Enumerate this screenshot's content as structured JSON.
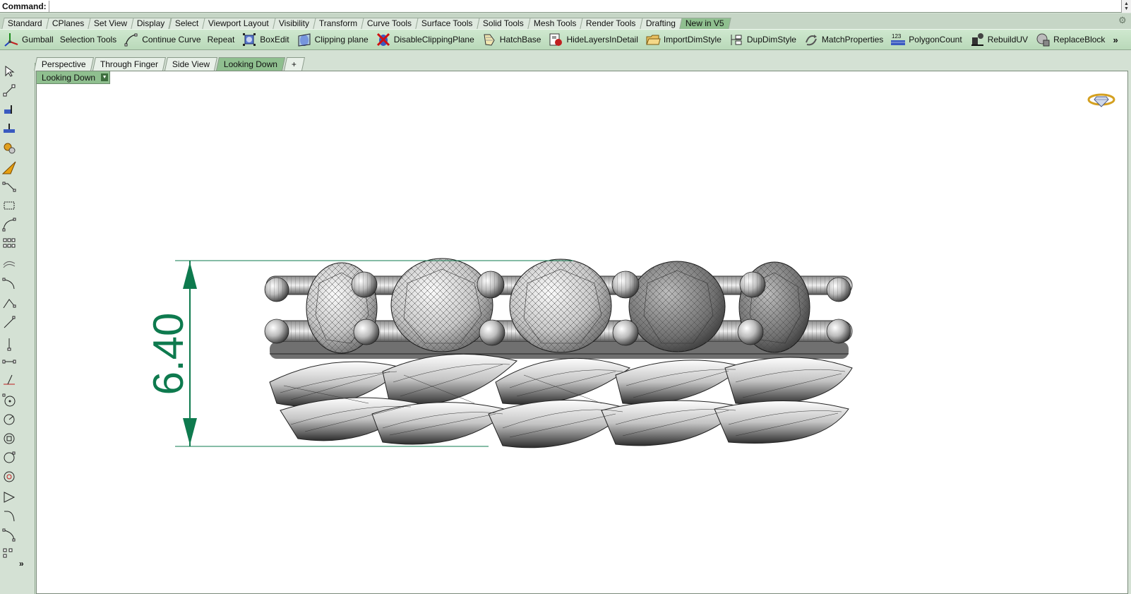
{
  "command": {
    "label": "Command:",
    "value": ""
  },
  "tabs": [
    {
      "label": "Standard",
      "active": false
    },
    {
      "label": "CPlanes",
      "active": false
    },
    {
      "label": "Set View",
      "active": false
    },
    {
      "label": "Display",
      "active": false
    },
    {
      "label": "Select",
      "active": false
    },
    {
      "label": "Viewport Layout",
      "active": false
    },
    {
      "label": "Visibility",
      "active": false
    },
    {
      "label": "Transform",
      "active": false
    },
    {
      "label": "Curve Tools",
      "active": false
    },
    {
      "label": "Surface Tools",
      "active": false
    },
    {
      "label": "Solid Tools",
      "active": false
    },
    {
      "label": "Mesh Tools",
      "active": false
    },
    {
      "label": "Render Tools",
      "active": false
    },
    {
      "label": "Drafting",
      "active": false
    },
    {
      "label": "New in V5",
      "active": true
    }
  ],
  "toolbar": [
    {
      "label": "Gumball",
      "icon": "gumball-icon"
    },
    {
      "label": "Selection Tools",
      "icon": ""
    },
    {
      "label": "Continue Curve",
      "icon": "continue-curve-icon"
    },
    {
      "label": "Repeat",
      "icon": ""
    },
    {
      "label": "BoxEdit",
      "icon": "box-edit-icon"
    },
    {
      "label": "Clipping plane",
      "icon": "clipping-plane-icon"
    },
    {
      "label": "DisableClippingPlane",
      "icon": "disable-clipping-icon"
    },
    {
      "label": "HatchBase",
      "icon": "hatch-icon"
    },
    {
      "label": "HideLayersInDetail",
      "icon": "hide-layers-icon"
    },
    {
      "label": "ImportDimStyle",
      "icon": "folder-icon"
    },
    {
      "label": "DupDimStyle",
      "icon": "dup-dim-icon"
    },
    {
      "label": "MatchProperties",
      "icon": "match-properties-icon"
    },
    {
      "label": "PolygonCount",
      "icon": "polygon-count-icon"
    },
    {
      "label": "RebuildUV",
      "icon": "rebuild-uv-icon"
    },
    {
      "label": "ReplaceBlock",
      "icon": "replace-block-icon"
    }
  ],
  "toolbar_more": "»",
  "left_toolbar_more": "»",
  "viewport_tabs": [
    {
      "label": "Perspective",
      "active": false
    },
    {
      "label": "Through Finger",
      "active": false
    },
    {
      "label": "Side View",
      "active": false
    },
    {
      "label": "Looking Down",
      "active": true
    }
  ],
  "viewport_add": "+",
  "viewport": {
    "title": "Looking Down",
    "dimension_value": "6.40"
  },
  "colors": {
    "accent_green": "#8fbf8f",
    "dimension_green": "#0e7a4e"
  }
}
